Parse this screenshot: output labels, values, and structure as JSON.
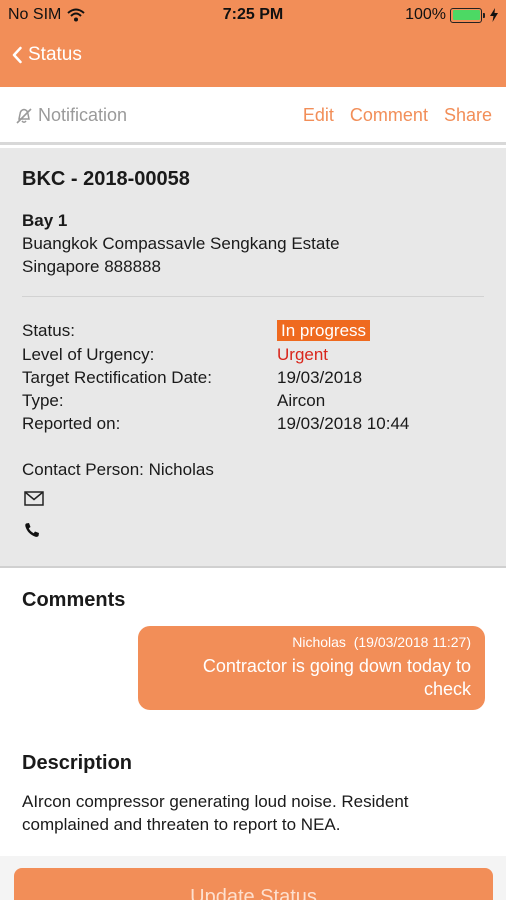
{
  "statusbar": {
    "carrier": "No SIM",
    "time": "7:25 PM",
    "battery": "100%",
    "battery_level": 1.0
  },
  "nav": {
    "back_label": "Status"
  },
  "toolbar": {
    "notification_label": "Notification",
    "edit_label": "Edit",
    "comment_label": "Comment",
    "share_label": "Share"
  },
  "report": {
    "ref": "BKC - 2018-00058",
    "location": "Bay 1",
    "address_line1": "Buangkok Compassavle Sengkang Estate",
    "address_line2": "Singapore 888888",
    "fields": [
      {
        "label": "Status:",
        "value": "In progress"
      },
      {
        "label": "Level of Urgency:",
        "value": "Urgent"
      },
      {
        "label": "Target Rectification Date:",
        "value": "19/03/2018"
      },
      {
        "label": "Type:",
        "value": "Aircon"
      },
      {
        "label": "Reported on:",
        "value": "19/03/2018 10:44"
      }
    ],
    "contact": "Contact Person: Nicholas"
  },
  "comments": {
    "title": "Comments",
    "items": [
      {
        "author": "Nicholas",
        "timestamp": "(19/03/2018 11:27)",
        "text_line1": "Contractor is going down today to",
        "text_line2": "check"
      }
    ]
  },
  "description": {
    "title": "Description",
    "text": "AIrcon compressor generating loud noise. Resident complained and threaten to report to NEA."
  },
  "actions": {
    "update_status_label": "Update Status"
  },
  "colors": {
    "accent": "#f28e58",
    "badge": "#ef6a1f",
    "urgent": "#d9261c",
    "panel": "#e8e8e8"
  },
  "icons": [
    "wifi-icon",
    "battery-icon",
    "charging-icon",
    "chevron-left-icon",
    "bell-off-icon",
    "mail-icon",
    "phone-icon"
  ]
}
